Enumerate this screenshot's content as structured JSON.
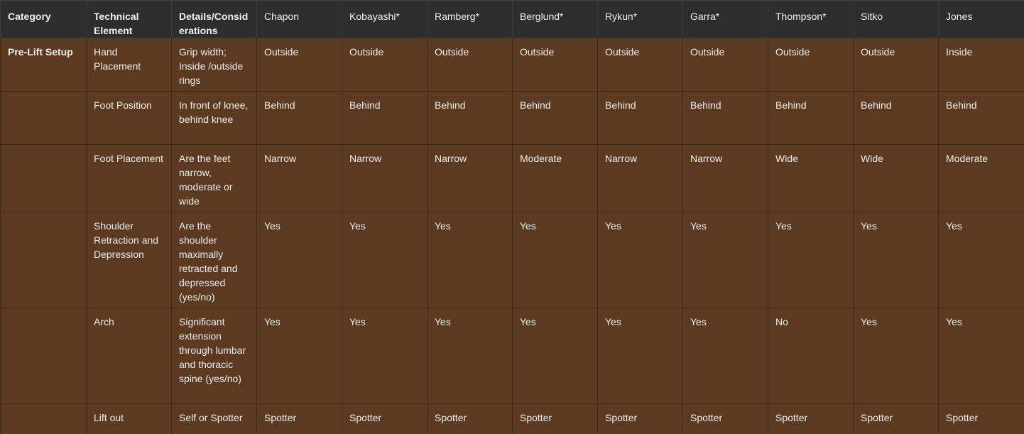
{
  "table": {
    "headers": [
      "Category",
      "Technical Element",
      "Details/Considerations",
      "Chapon",
      "Kobayashi*",
      "Ramberg*",
      "Berglund*",
      "Rykun*",
      "Garra*",
      "Thompson*",
      "Sitko",
      "Jones"
    ],
    "rows": [
      {
        "category": "Pre-Lift Setup",
        "element": "Hand Placement",
        "details": "Grip width; Inside /outside rings",
        "values": [
          "Outside",
          "Outside",
          "Outside",
          "Outside",
          "Outside",
          "Outside",
          "Outside",
          "Outside",
          "Inside"
        ]
      },
      {
        "category": "",
        "element": "Foot Position",
        "details": "In front of knee, behind knee",
        "values": [
          "Behind",
          "Behind",
          "Behind",
          "Behind",
          "Behind",
          "Behind",
          "Behind",
          "Behind",
          "Behind"
        ]
      },
      {
        "category": "",
        "element": "Foot Placement",
        "details": "Are the feet narrow, moderate or wide",
        "values": [
          "Narrow",
          "Narrow",
          "Narrow",
          "Moderate",
          "Narrow",
          "Narrow",
          "Wide",
          "Wide",
          "Moderate"
        ]
      },
      {
        "category": "",
        "element": "Shoulder Retraction and Depression",
        "details": "Are the shoulder maximally retracted and depressed (yes/no)",
        "values": [
          "Yes",
          "Yes",
          "Yes",
          "Yes",
          "Yes",
          "Yes",
          "Yes",
          "Yes",
          "Yes"
        ]
      },
      {
        "category": "",
        "element": "Arch",
        "details": "Significant extension through lumbar and thoracic spine (yes/no)",
        "values": [
          "Yes",
          "Yes",
          "Yes",
          "Yes",
          "Yes",
          "Yes",
          "No",
          "Yes",
          "Yes"
        ]
      },
      {
        "category": "",
        "element": "Lift out",
        "details": "Self or Spotter",
        "values": [
          "Spotter",
          "Spotter",
          "Spotter",
          "Spotter",
          "Spotter",
          "Spotter",
          "Spotter",
          "Spotter",
          "Spotter"
        ]
      }
    ]
  },
  "colors": {
    "header_bg": "#2d2d2d",
    "cell_bg": "#5b3a21",
    "text": "#ededed"
  }
}
